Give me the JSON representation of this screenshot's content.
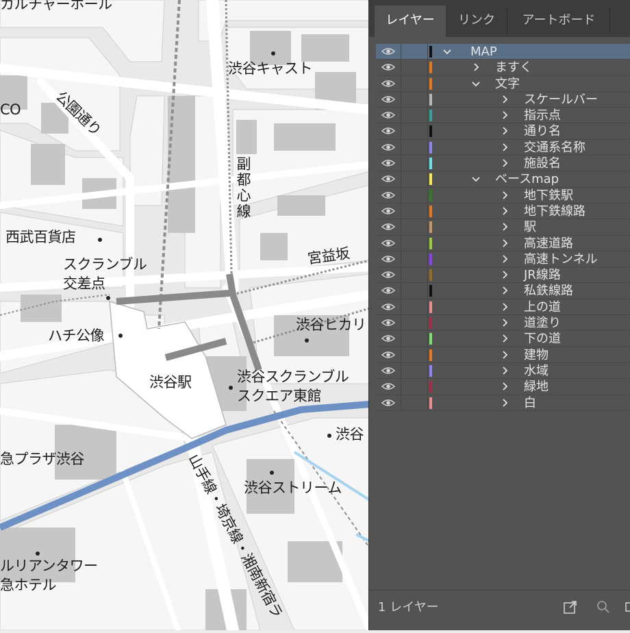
{
  "map": {
    "labels": {
      "culture_hall": "カルチャーホール",
      "shibuya_cast": "渋谷キャスト",
      "parco": "CO",
      "koen_dori": "公園通り",
      "fukutoshin_line": "副都心線",
      "seibu": "西武百貨店",
      "scramble": "スクランブル",
      "crossing": "交差点",
      "miyamasuzaka": "宮益坂",
      "hikarie": "渋谷ヒカリ",
      "hachiko": "ハチ公像",
      "shibuya_station": "渋谷駅",
      "scramble_square_1": "渋谷スクランブル",
      "scramble_square_2": "スクエア東館",
      "shibuya_small": "渋谷",
      "tokyu_plaza": "急プラザ渋谷",
      "yamanote": "山手線・埼京線・湘南新宿ラ",
      "stream": "渋谷ストリーム",
      "cerulean_1": "ルリアンタワー",
      "cerulean_2": "急ホテル"
    }
  },
  "panel": {
    "tabs": [
      {
        "label": "レイヤー",
        "active": true
      },
      {
        "label": "リンク",
        "active": false
      },
      {
        "label": "アートボード",
        "active": false
      }
    ],
    "layers": [
      {
        "name": "MAP",
        "color": "#111111",
        "level": 0,
        "expanded": true,
        "selected": true
      },
      {
        "name": "ますく",
        "color": "#e8781e",
        "level": 1,
        "expanded": false
      },
      {
        "name": "文字",
        "color": "#e8781e",
        "level": 1,
        "expanded": true
      },
      {
        "name": "スケールバー",
        "color": "#b7b7b7",
        "level": 2,
        "expanded": false
      },
      {
        "name": "指示点",
        "color": "#2fa39a",
        "level": 2,
        "expanded": false
      },
      {
        "name": "通り名",
        "color": "#111111",
        "level": 2,
        "expanded": false
      },
      {
        "name": "交通系名称",
        "color": "#8d86f2",
        "level": 2,
        "expanded": false
      },
      {
        "name": "施設名",
        "color": "#6ae3e8",
        "level": 2,
        "expanded": false
      },
      {
        "name": "ベースmap",
        "color": "#f3ec4c",
        "level": 1,
        "expanded": true
      },
      {
        "name": "地下鉄駅",
        "color": "#2e7d1f",
        "level": 2,
        "expanded": false
      },
      {
        "name": "地下鉄線路",
        "color": "#e8781e",
        "level": 2,
        "expanded": false
      },
      {
        "name": "駅",
        "color": "#c79566",
        "level": 2,
        "expanded": false
      },
      {
        "name": "高速道路",
        "color": "#9ccc3a",
        "level": 2,
        "expanded": false
      },
      {
        "name": "高速トンネル",
        "color": "#8a3ef0",
        "level": 2,
        "expanded": false
      },
      {
        "name": "JR線路",
        "color": "#9a6a22",
        "level": 2,
        "expanded": false
      },
      {
        "name": "私鉄線路",
        "color": "#111111",
        "level": 2,
        "expanded": false
      },
      {
        "name": "上の道",
        "color": "#f08e8e",
        "level": 2,
        "expanded": false
      },
      {
        "name": "道塗り",
        "color": "#a82c44",
        "level": 2,
        "expanded": false
      },
      {
        "name": "下の道",
        "color": "#7be36a",
        "level": 2,
        "expanded": false
      },
      {
        "name": "建物",
        "color": "#e8781e",
        "level": 2,
        "expanded": false
      },
      {
        "name": "水域",
        "color": "#8d86f2",
        "level": 2,
        "expanded": false
      },
      {
        "name": "緑地",
        "color": "#a82c44",
        "level": 2,
        "expanded": false
      },
      {
        "name": "白",
        "color": "#f08e8e",
        "level": 2,
        "expanded": false
      }
    ],
    "footer": {
      "count_label": "1 レイヤー"
    }
  }
}
